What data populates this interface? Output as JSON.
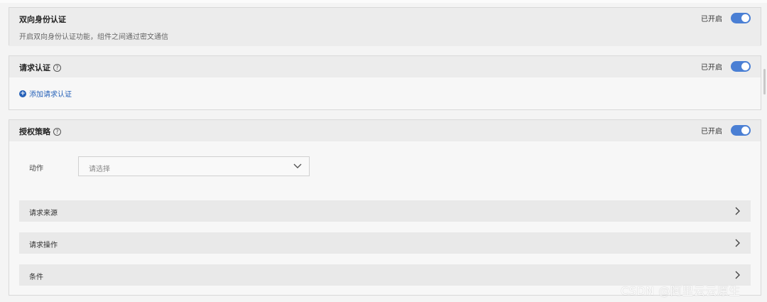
{
  "panels": {
    "mutual_auth": {
      "title": "双向身份认证",
      "status": "已开启",
      "description": "开启双向身份认证功能，组件之间通过密文通信"
    },
    "request_auth": {
      "title": "请求认证",
      "help_icon": "?",
      "status": "已开启",
      "add_link": "添加请求认证",
      "add_icon": "+"
    },
    "auth_policy": {
      "title": "授权策略",
      "help_icon": "?",
      "status": "已开启",
      "action_label": "动作",
      "action_placeholder": "请选择",
      "rows": [
        {
          "label": "请求来源"
        },
        {
          "label": "请求操作"
        },
        {
          "label": "条件"
        }
      ]
    }
  },
  "watermark": "CSDN @阿里云云原生",
  "colors": {
    "toggle_on": "#4a7fd4",
    "link": "#2460b8"
  }
}
